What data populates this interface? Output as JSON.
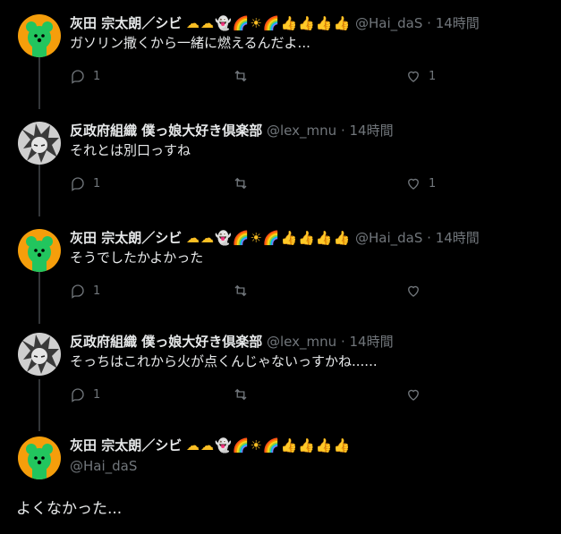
{
  "emoji_row": "☁☁👻🌈☀🌈👍👍👍👍",
  "tweets": [
    {
      "name": "灰田 宗太朗／シビ",
      "handle": "@Hai_daS",
      "time": "14時間",
      "text": "ガソリン撒くから一緒に燃えるんだよ...",
      "reply_count": "1",
      "like_count": "1"
    },
    {
      "name": "反政府組織 僕っ娘大好き倶楽部",
      "handle": "@lex_mnu",
      "time": "14時間",
      "text": "それとは別口っすね",
      "reply_count": "1",
      "like_count": "1"
    },
    {
      "name": "灰田 宗太朗／シビ",
      "handle": "@Hai_daS",
      "time": "14時間",
      "text": "そうでしたかよかった",
      "reply_count": "1",
      "like_count": ""
    },
    {
      "name": "反政府組織 僕っ娘大好き倶楽部",
      "handle": "@lex_mnu",
      "time": "14時間",
      "text": "そっちはこれから火が点くんじゃないっすかね......",
      "reply_count": "1",
      "like_count": ""
    }
  ],
  "focus_tweet": {
    "name": "灰田 宗太朗／シビ",
    "handle": "@Hai_daS",
    "text": "よくなかった..."
  },
  "separator": "·",
  "colors": {
    "background": "#000000",
    "muted": "#71767b",
    "text": "#e7e9ea",
    "avatar_bg": "#f59e0b",
    "bear": "#22c55e"
  }
}
